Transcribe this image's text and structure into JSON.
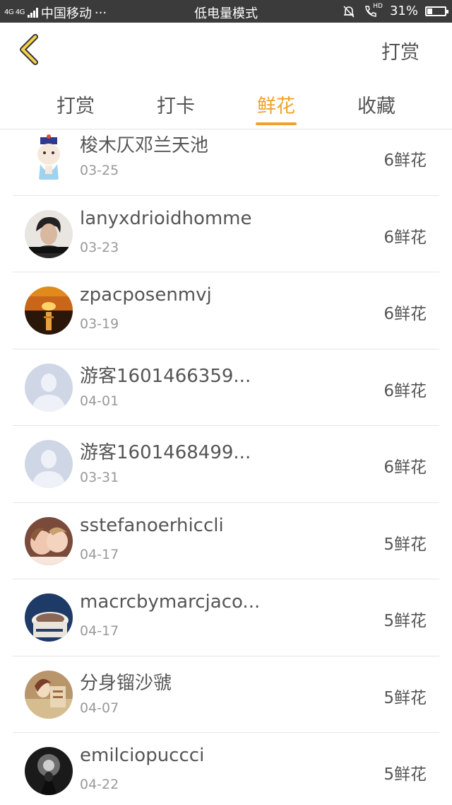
{
  "status_bar": {
    "network": "4G 4G",
    "carrier": "中国移动",
    "more": "···",
    "mode": "低电量模式",
    "hd": "HD",
    "battery_percent": "31%",
    "battery_level": 0.31
  },
  "nav": {
    "back_icon": "chevron-left-icon",
    "action_label": "打赏"
  },
  "tabs": [
    {
      "label": "打赏",
      "active": false
    },
    {
      "label": "打卡",
      "active": false
    },
    {
      "label": "鲜花",
      "active": true
    },
    {
      "label": "收藏",
      "active": false
    }
  ],
  "rows": [
    {
      "name": "梭木仄邓兰天池",
      "date": "03-25",
      "count": "6鲜花",
      "avatar": "cartoon-avatar"
    },
    {
      "name": "lanyxdrioidhomme",
      "date": "03-23",
      "count": "6鲜花",
      "avatar": "photo-avatar"
    },
    {
      "name": "zpacposenmvj",
      "date": "03-19",
      "count": "6鲜花",
      "avatar": "sunset-avatar"
    },
    {
      "name": "游客1601466359...",
      "date": "04-01",
      "count": "6鲜花",
      "avatar": "default-avatar"
    },
    {
      "name": "游客1601468499...",
      "date": "03-31",
      "count": "6鲜花",
      "avatar": "default-avatar"
    },
    {
      "name": "sstefanoerhiccli",
      "date": "04-17",
      "count": "5鲜花",
      "avatar": "photo-avatar"
    },
    {
      "name": "macrcbymarcjaco...",
      "date": "04-17",
      "count": "5鲜花",
      "avatar": "photo-avatar"
    },
    {
      "name": "分身镏沙虢",
      "date": "04-07",
      "count": "5鲜花",
      "avatar": "photo-avatar"
    },
    {
      "name": "emilciopuccci",
      "date": "04-22",
      "count": "5鲜花",
      "avatar": "photo-avatar"
    }
  ]
}
